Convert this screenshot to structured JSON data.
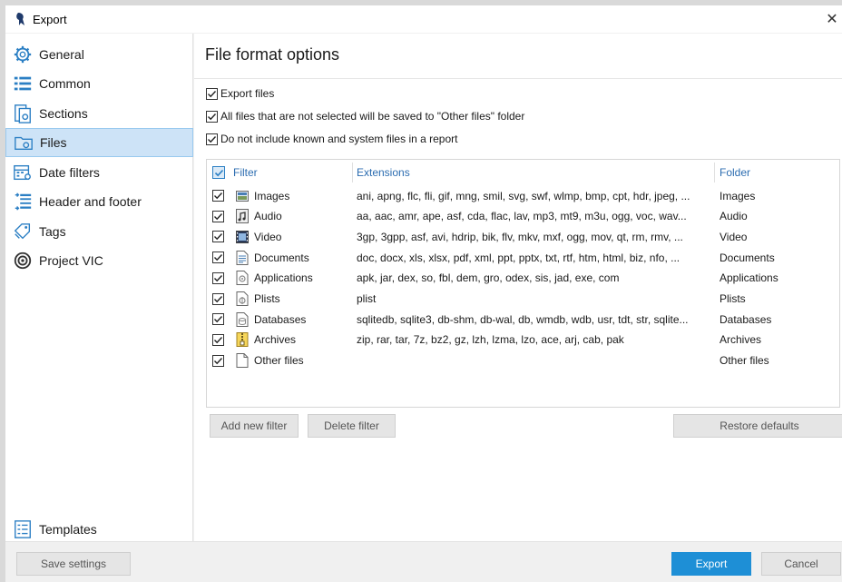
{
  "window": {
    "title": "Export",
    "close_glyph": "✕"
  },
  "sidebar": {
    "items": [
      {
        "label": "General",
        "icon": "gear-icon"
      },
      {
        "label": "Common",
        "icon": "list-icon"
      },
      {
        "label": "Sections",
        "icon": "sections-icon"
      },
      {
        "label": "Files",
        "icon": "files-icon",
        "active": true
      },
      {
        "label": "Date filters",
        "icon": "calendar-icon"
      },
      {
        "label": "Header and footer",
        "icon": "header-footer-icon"
      },
      {
        "label": "Tags",
        "icon": "tags-icon"
      },
      {
        "label": "Project VIC",
        "icon": "project-vic-icon"
      }
    ],
    "templates_label": "Templates"
  },
  "content": {
    "title": "File format options",
    "options": [
      {
        "label": "Export files",
        "checked": true
      },
      {
        "label": "All files that are not selected will be saved to \"Other files\" folder",
        "checked": true
      },
      {
        "label": "Do not include known and system files in a report",
        "checked": true
      }
    ],
    "grid": {
      "columns": [
        "Filter",
        "Extensions",
        "Folder"
      ],
      "rows": [
        {
          "filter": "Images",
          "icon": "image-file-icon",
          "extensions": "ani, apng, flc, fli, gif, mng, smil, svg, swf, wlmp, bmp, cpt, hdr, jpeg, ...",
          "folder": "Images",
          "checked": true
        },
        {
          "filter": "Audio",
          "icon": "audio-file-icon",
          "extensions": "aa, aac, amr, ape, asf, cda, flac, lav, mp3, mt9, m3u, ogg, voc, wav...",
          "folder": "Audio",
          "checked": true
        },
        {
          "filter": "Video",
          "icon": "video-file-icon",
          "extensions": "3gp, 3gpp, asf, avi, hdrip, bik, flv, mkv, mxf, ogg, mov, qt, rm, rmv, ...",
          "folder": "Video",
          "checked": true
        },
        {
          "filter": "Documents",
          "icon": "document-file-icon",
          "extensions": "doc, docx, xls, xlsx, pdf, xml, ppt, pptx, txt, rtf, htm, html, biz, nfo, ...",
          "folder": "Documents",
          "checked": true
        },
        {
          "filter": "Applications",
          "icon": "application-file-icon",
          "extensions": "apk, jar, dex, so, fbl, dem, gro, odex, sis, jad, exe, com",
          "folder": "Applications",
          "checked": true
        },
        {
          "filter": "Plists",
          "icon": "plist-file-icon",
          "extensions": "plist",
          "folder": "Plists",
          "checked": true
        },
        {
          "filter": "Databases",
          "icon": "database-file-icon",
          "extensions": "sqlitedb, sqlite3, db-shm, db-wal, db, wmdb, wdb, usr, tdt, str, sqlite...",
          "folder": "Databases",
          "checked": true
        },
        {
          "filter": "Archives",
          "icon": "archive-file-icon",
          "extensions": "zip, rar, tar, 7z, bz2, gz, lzh, lzma, lzo, ace, arj, cab, pak",
          "folder": "Archives",
          "checked": true
        },
        {
          "filter": "Other files",
          "icon": "generic-file-icon",
          "extensions": "",
          "folder": "Other files",
          "checked": true
        }
      ]
    },
    "buttons": {
      "add_filter": "Add new filter",
      "delete_filter": "Delete filter",
      "restore_defaults": "Restore defaults"
    }
  },
  "footer": {
    "save_settings": "Save settings",
    "export": "Export",
    "cancel": "Cancel"
  },
  "colors": {
    "accent": "#1e8fd6",
    "selected_bg": "#cde3f7",
    "header_text": "#2b6cb0"
  }
}
